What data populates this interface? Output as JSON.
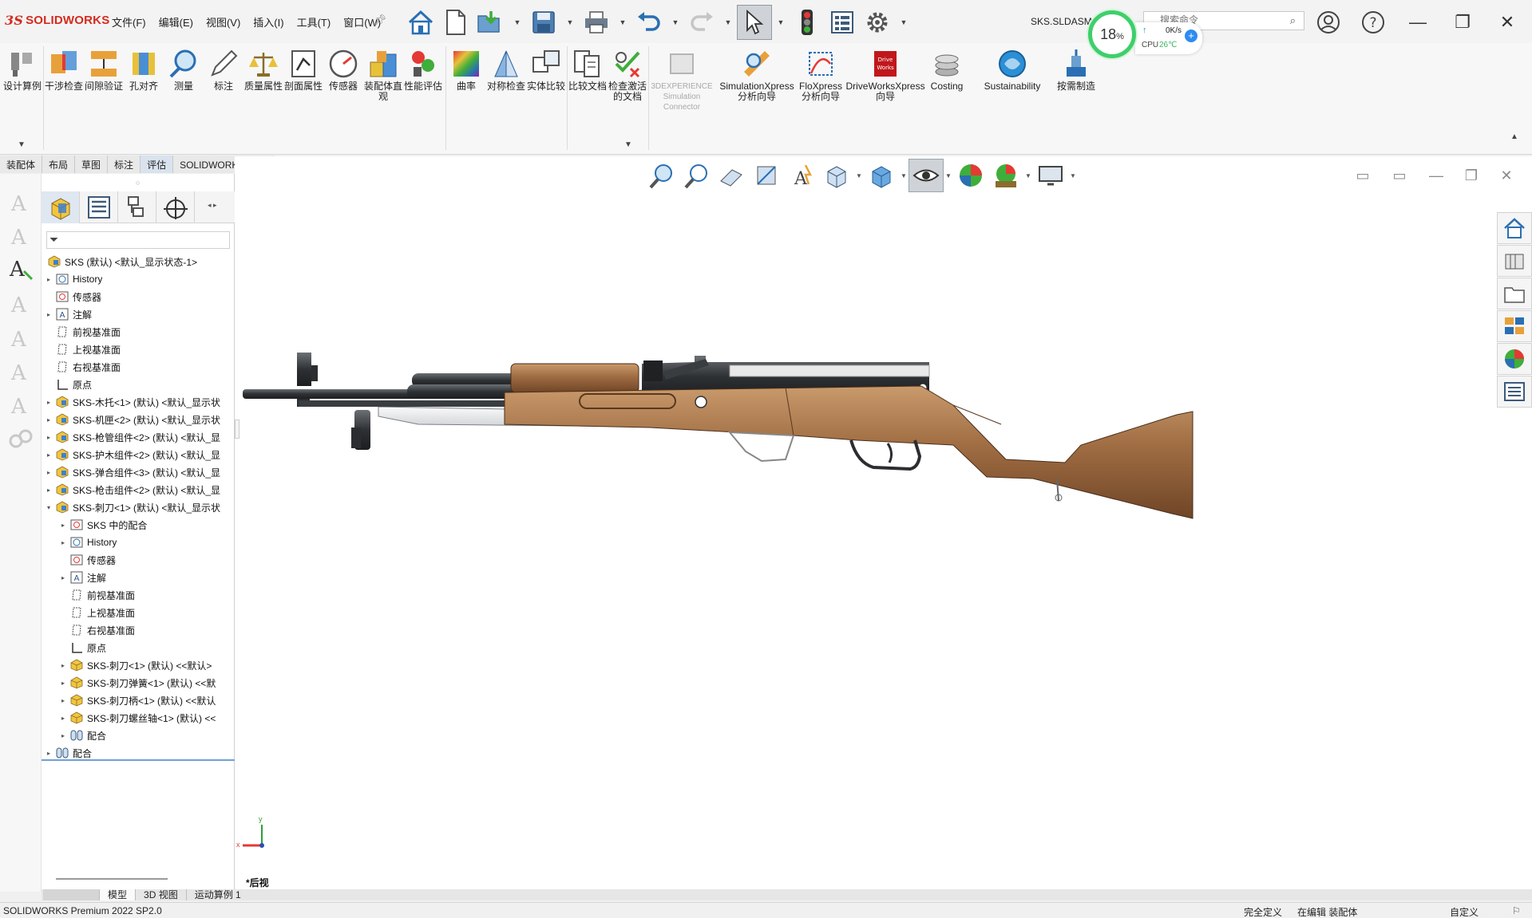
{
  "app": {
    "logo_ds": "3S",
    "logo_text": "SOLIDWORKS",
    "filename": "SKS.SLDASM",
    "menus": [
      "文件(F)",
      "编辑(E)",
      "视图(V)",
      "插入(I)",
      "工具(T)",
      "窗口(W)"
    ]
  },
  "monitor": {
    "cpu_percent": "18",
    "percent_sign": "%",
    "net": "0K/s",
    "cpu_label": "CPU",
    "temp": "26℃"
  },
  "search": {
    "placeholder": "搜索命令"
  },
  "ribbon": {
    "items": [
      "设计算例",
      "干涉检查",
      "间隙验证",
      "孔对齐",
      "测量",
      "标注",
      "质量属性",
      "剖面属性",
      "传感器",
      "装配体直观",
      "性能评估",
      "曲率",
      "对称检查",
      "实体比较",
      "比较文档",
      "检查激活的文档",
      "3DEXPERIENCE Simulation Connector",
      "SimulationXpress 分析向导",
      "FloXpress 分析向导",
      "DriveWorksXpress 向导",
      "Costing",
      "Sustainability",
      "按需制造"
    ]
  },
  "cmd_tabs": [
    "装配体",
    "布局",
    "草图",
    "标注",
    "评估",
    "SOLIDWORKS 插件"
  ],
  "tree": {
    "nodes": [
      {
        "label": "SKS (默认) <默认_显示状态-1>",
        "level": 0,
        "toggle": "",
        "icon": "assembly"
      },
      {
        "label": "History",
        "level": 1,
        "toggle": "▸",
        "icon": "history"
      },
      {
        "label": "传感器",
        "level": 1,
        "toggle": "",
        "icon": "sensor"
      },
      {
        "label": "注解",
        "level": 1,
        "toggle": "▸",
        "icon": "annotation"
      },
      {
        "label": "前视基准面",
        "level": 1,
        "toggle": "",
        "icon": "plane"
      },
      {
        "label": "上视基准面",
        "level": 1,
        "toggle": "",
        "icon": "plane"
      },
      {
        "label": "右视基准面",
        "level": 1,
        "toggle": "",
        "icon": "plane"
      },
      {
        "label": "原点",
        "level": 1,
        "toggle": "",
        "icon": "origin"
      },
      {
        "label": "SKS-木托<1> (默认) <默认_显示状",
        "level": 1,
        "toggle": "▸",
        "icon": "assembly"
      },
      {
        "label": "SKS-机匣<2> (默认) <默认_显示状",
        "level": 1,
        "toggle": "▸",
        "icon": "assembly"
      },
      {
        "label": "SKS-枪管组件<2> (默认) <默认_显",
        "level": 1,
        "toggle": "▸",
        "icon": "assembly"
      },
      {
        "label": "SKS-护木组件<2> (默认) <默认_显",
        "level": 1,
        "toggle": "▸",
        "icon": "assembly"
      },
      {
        "label": "SKS-弹合组件<3> (默认) <默认_显",
        "level": 1,
        "toggle": "▸",
        "icon": "assembly"
      },
      {
        "label": "SKS-枪击组件<2> (默认) <默认_显",
        "level": 1,
        "toggle": "▸",
        "icon": "assembly"
      },
      {
        "label": "SKS-刺刀<1> (默认) <默认_显示状",
        "level": 1,
        "toggle": "▾",
        "icon": "assembly"
      },
      {
        "label": "SKS 中的配合",
        "level": 2,
        "toggle": "▸",
        "icon": "sensor"
      },
      {
        "label": "History",
        "level": 2,
        "toggle": "▸",
        "icon": "history"
      },
      {
        "label": "传感器",
        "level": 2,
        "toggle": "",
        "icon": "sensor"
      },
      {
        "label": "注解",
        "level": 2,
        "toggle": "▸",
        "icon": "annotation"
      },
      {
        "label": "前视基准面",
        "level": 2,
        "toggle": "",
        "icon": "plane"
      },
      {
        "label": "上视基准面",
        "level": 2,
        "toggle": "",
        "icon": "plane"
      },
      {
        "label": "右视基准面",
        "level": 2,
        "toggle": "",
        "icon": "plane"
      },
      {
        "label": "原点",
        "level": 2,
        "toggle": "",
        "icon": "origin"
      },
      {
        "label": "SKS-刺刀<1> (默认) <<默认>",
        "level": 2,
        "toggle": "▸",
        "icon": "part"
      },
      {
        "label": "SKS-刺刀弹簧<1> (默认) <<默",
        "level": 2,
        "toggle": "▸",
        "icon": "part"
      },
      {
        "label": "SKS-刺刀柄<1> (默认) <<默认",
        "level": 2,
        "toggle": "▸",
        "icon": "part"
      },
      {
        "label": "SKS-刺刀螺丝轴<1> (默认) <<",
        "level": 2,
        "toggle": "▸",
        "icon": "part"
      },
      {
        "label": "配合",
        "level": 2,
        "toggle": "▸",
        "icon": "mate"
      },
      {
        "label": "配合",
        "level": 1,
        "toggle": "▸",
        "icon": "mate"
      }
    ]
  },
  "bottom_tabs": [
    "模型",
    "3D 视图",
    "运动算例 1"
  ],
  "viewport": {
    "view_name": "*后视",
    "triad_x": "x",
    "triad_y": "y"
  },
  "status": {
    "version": "SOLIDWORKS Premium 2022 SP2.0",
    "state": "完全定义",
    "mode": "在编辑 装配体",
    "custom": "自定义"
  },
  "colors": {
    "accent": "#d52b1e",
    "wood": "#9b6a44",
    "metal": "#3a3d40"
  }
}
